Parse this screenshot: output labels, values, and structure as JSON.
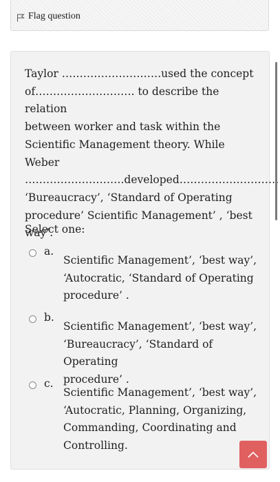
{
  "flag": {
    "label": "Flag question"
  },
  "question": {
    "lines": [
      "Taylor ……………………….used the concept",
      "of………………………. to describe the relation",
      "between worker and task within the",
      "Scientific Management theory. While Weber",
      "……………………….developed……………………….",
      "‘Bureaucracy’, ‘Standard of Operating",
      "procedure’ Scientific Management’ , ‘best",
      "way’."
    ],
    "prompt": "Select one:"
  },
  "answers": [
    {
      "letter": "a.",
      "lines": [
        "Scientific Management’, ‘best way’,",
        "‘Autocratic, ‘Standard of Operating",
        "procedure’ ."
      ]
    },
    {
      "letter": "b.",
      "lines": [
        "Scientific Management’, ‘best way’,",
        "‘Bureaucracy’, ‘Standard of Operating",
        "procedure’ ."
      ]
    },
    {
      "letter": "c.",
      "lines": [
        "Scientific Management’, ‘best way’,",
        "‘Autocratic, Planning, Organizing,",
        "Commanding, Coordinating and",
        "Controlling."
      ]
    }
  ],
  "icons": {
    "flag": "flag-icon",
    "back_to_top": "chevron-up-icon"
  },
  "colors": {
    "accent": "#e06060",
    "card_bg": "#f2f2f3"
  }
}
